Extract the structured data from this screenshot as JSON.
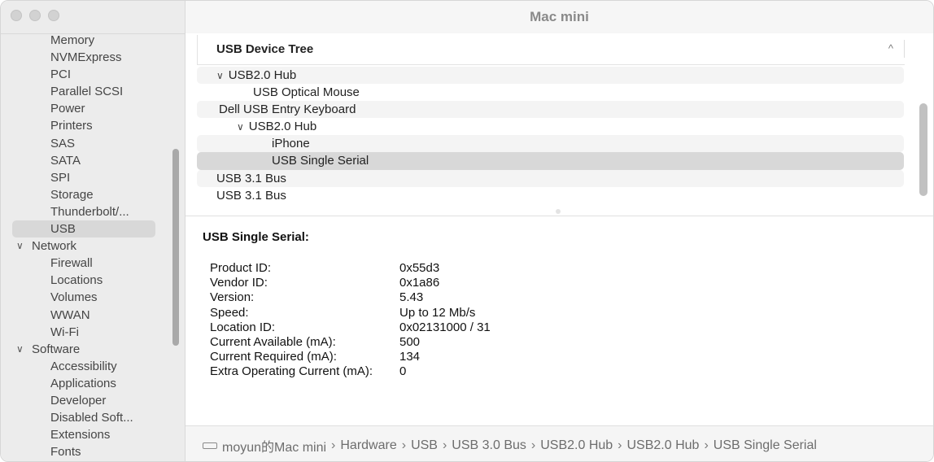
{
  "window": {
    "title": "Mac mini"
  },
  "sidebar": {
    "items": [
      {
        "label": "Memory",
        "kind": "child"
      },
      {
        "label": "NVMExpress",
        "kind": "child"
      },
      {
        "label": "PCI",
        "kind": "child"
      },
      {
        "label": "Parallel SCSI",
        "kind": "child"
      },
      {
        "label": "Power",
        "kind": "child"
      },
      {
        "label": "Printers",
        "kind": "child"
      },
      {
        "label": "SAS",
        "kind": "child"
      },
      {
        "label": "SATA",
        "kind": "child"
      },
      {
        "label": "SPI",
        "kind": "child"
      },
      {
        "label": "Storage",
        "kind": "child"
      },
      {
        "label": "Thunderbolt/...",
        "kind": "child"
      },
      {
        "label": "USB",
        "kind": "child",
        "selected": true
      },
      {
        "label": "Network",
        "kind": "group"
      },
      {
        "label": "Firewall",
        "kind": "child"
      },
      {
        "label": "Locations",
        "kind": "child"
      },
      {
        "label": "Volumes",
        "kind": "child"
      },
      {
        "label": "WWAN",
        "kind": "child"
      },
      {
        "label": "Wi-Fi",
        "kind": "child"
      },
      {
        "label": "Software",
        "kind": "group"
      },
      {
        "label": "Accessibility",
        "kind": "child"
      },
      {
        "label": "Applications",
        "kind": "child"
      },
      {
        "label": "Developer",
        "kind": "child"
      },
      {
        "label": "Disabled Soft...",
        "kind": "child"
      },
      {
        "label": "Extensions",
        "kind": "child"
      },
      {
        "label": "Fonts",
        "kind": "child"
      }
    ]
  },
  "tree": {
    "header": "USB Device Tree",
    "rows": [
      {
        "label": "USB2.0 Hub",
        "expanded": true
      },
      {
        "label": "USB Optical Mouse"
      },
      {
        "label": "Dell USB Entry Keyboard"
      },
      {
        "label": "USB2.0 Hub",
        "expanded": true
      },
      {
        "label": "iPhone"
      },
      {
        "label": "USB Single Serial",
        "selected": true
      },
      {
        "label": "USB 3.1 Bus"
      },
      {
        "label": "USB 3.1 Bus"
      }
    ]
  },
  "details": {
    "title": "USB Single Serial:",
    "properties": [
      {
        "key": "Product ID:",
        "value": "0x55d3"
      },
      {
        "key": "Vendor ID:",
        "value": "0x1a86"
      },
      {
        "key": "Version:",
        "value": "5.43"
      },
      {
        "key": "Speed:",
        "value": "Up to 12 Mb/s"
      },
      {
        "key": "Location ID:",
        "value": "0x02131000 / 31"
      },
      {
        "key": "Current Available (mA):",
        "value": "500"
      },
      {
        "key": "Current Required (mA):",
        "value": "134"
      },
      {
        "key": "Extra Operating Current (mA):",
        "value": "0"
      }
    ]
  },
  "statusbar": {
    "icon": "mac-mini-icon",
    "separator": "›",
    "path": [
      "moyun的Mac mini",
      "Hardware",
      "USB",
      "USB 3.0 Bus",
      "USB2.0 Hub",
      "USB2.0 Hub",
      "USB Single Serial"
    ]
  }
}
